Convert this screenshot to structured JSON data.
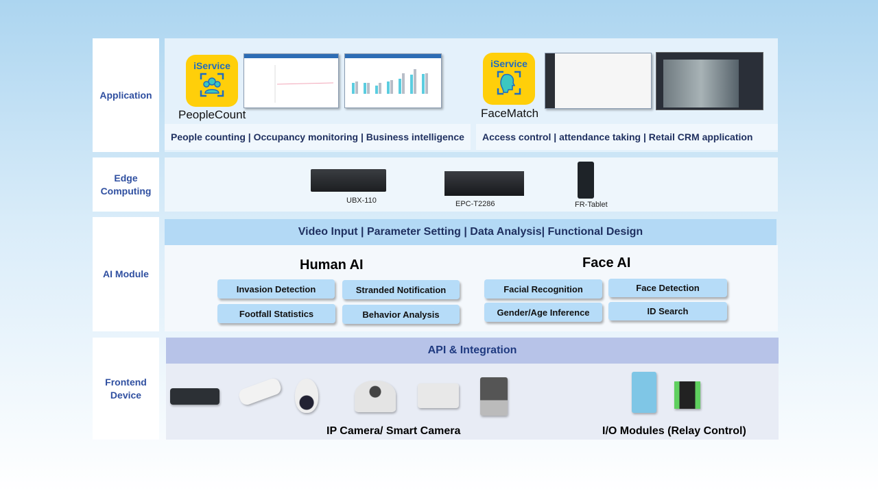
{
  "layers": {
    "application": "Application",
    "edge": "Edge Computing",
    "ai": "AI Module",
    "frontend": "Frontend Device"
  },
  "application": {
    "apps": [
      {
        "brand": "iService",
        "name": "PeopleCount",
        "icon": "people-group-icon",
        "tagline": "People counting | Occupancy monitoring | Business intelligence"
      },
      {
        "brand": "iService",
        "name": "FaceMatch",
        "icon": "face-scan-icon",
        "tagline": "Access control | attendance taking | Retail CRM application"
      }
    ]
  },
  "edge": {
    "devices": [
      "UBX-110",
      "EPC-T2286",
      "FR-Tablet"
    ]
  },
  "ai": {
    "header": "Video Input | Parameter Setting | Data Analysis| Functional Design",
    "human": {
      "title": "Human AI",
      "items": [
        "Invasion Detection",
        "Stranded Notification",
        "Footfall Statistics",
        "Behavior Analysis"
      ]
    },
    "face": {
      "title": "Face AI",
      "items": [
        "Facial Recognition",
        "Face Detection",
        "Gender/Age Inference",
        "ID Search"
      ]
    }
  },
  "frontend": {
    "header": "API & Integration",
    "cameras_label": "IP Camera/ Smart Camera",
    "io_label": "I/O Modules (Relay Control)"
  },
  "colors": {
    "label_text": "#2f4fa0",
    "ai_header": "#b3d9f5",
    "api_header": "#b7c3e8",
    "chip": "#b6dcf8",
    "app_icon": "#ffcf0a"
  }
}
